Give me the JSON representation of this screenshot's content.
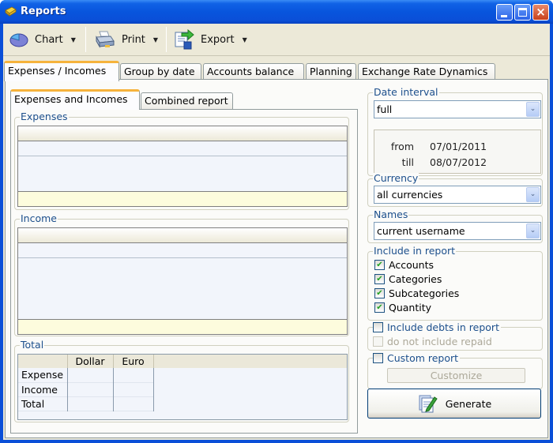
{
  "window": {
    "title": "Reports",
    "controls": {
      "minimize": "minimize",
      "maximize": "maximize",
      "close": "×"
    }
  },
  "toolbar": {
    "items": [
      {
        "label": "Chart",
        "icon": "pie-chart-icon",
        "has_dropdown": true
      },
      {
        "label": "Print",
        "icon": "printer-icon",
        "has_dropdown": true
      },
      {
        "label": "Export",
        "icon": "export-icon",
        "has_dropdown": true
      }
    ],
    "caret": "▼"
  },
  "main_tabs": [
    {
      "label": "Expenses / Incomes",
      "active": true
    },
    {
      "label": "Group by date",
      "active": false
    },
    {
      "label": "Accounts balance",
      "active": false
    },
    {
      "label": "Planning",
      "active": false
    },
    {
      "label": "Exchange Rate Dynamics",
      "active": false
    }
  ],
  "sub_tabs": [
    {
      "label": "Expenses and Incomes",
      "active": true
    },
    {
      "label": "Combined report",
      "active": false
    }
  ],
  "expenses": {
    "title": "Expenses",
    "rows": []
  },
  "income": {
    "title": "Income",
    "rows": []
  },
  "total": {
    "title": "Total",
    "columns": [
      "",
      "Dollar",
      "Euro"
    ],
    "rows": [
      {
        "label": "Expense",
        "dollar": "",
        "euro": ""
      },
      {
        "label": "Income",
        "dollar": "",
        "euro": ""
      },
      {
        "label": "Total",
        "dollar": "",
        "euro": ""
      }
    ]
  },
  "date_interval": {
    "title": "Date interval",
    "selected": "full",
    "from_label": "from",
    "from_value": "07/01/2011",
    "till_label": "till",
    "till_value": "08/07/2012"
  },
  "currency": {
    "title": "Currency",
    "selected": "all currencies"
  },
  "names": {
    "title": "Names",
    "selected": "current username"
  },
  "include": {
    "title": "Include in report",
    "options": [
      {
        "label": "Accounts",
        "checked": true
      },
      {
        "label": "Categories",
        "checked": true
      },
      {
        "label": "Subcategories",
        "checked": true
      },
      {
        "label": "Quantity",
        "checked": true
      }
    ]
  },
  "debts": {
    "label": "Include debts in report",
    "checked": false,
    "sub_label": "do not include repaid",
    "sub_checked": false,
    "sub_enabled": false
  },
  "custom_report": {
    "label": "Custom report",
    "checked": false,
    "customize_label": "Customize",
    "customize_enabled": false
  },
  "generate": {
    "label": "Generate"
  },
  "check_glyph": "✔",
  "combo_glyph": "⌄",
  "colors": {
    "titlebar": "#0a4fd8",
    "group_legend": "#1c4f8c",
    "grid_footer": "#fdfcdd",
    "active_tab_accent": "#f6b33c"
  }
}
